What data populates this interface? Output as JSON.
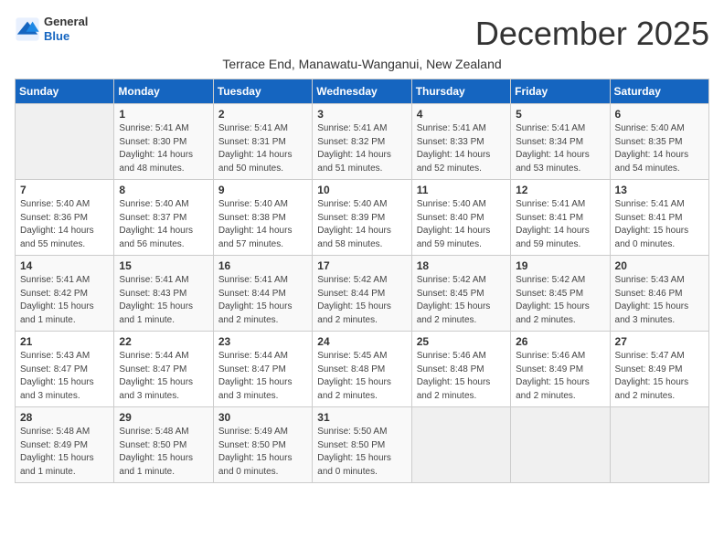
{
  "header": {
    "logo_general": "General",
    "logo_blue": "Blue",
    "month_title": "December 2025",
    "subtitle": "Terrace End, Manawatu-Wanganui, New Zealand"
  },
  "weekdays": [
    "Sunday",
    "Monday",
    "Tuesday",
    "Wednesday",
    "Thursday",
    "Friday",
    "Saturday"
  ],
  "weeks": [
    [
      {
        "day": "",
        "info": ""
      },
      {
        "day": "1",
        "info": "Sunrise: 5:41 AM\nSunset: 8:30 PM\nDaylight: 14 hours\nand 48 minutes."
      },
      {
        "day": "2",
        "info": "Sunrise: 5:41 AM\nSunset: 8:31 PM\nDaylight: 14 hours\nand 50 minutes."
      },
      {
        "day": "3",
        "info": "Sunrise: 5:41 AM\nSunset: 8:32 PM\nDaylight: 14 hours\nand 51 minutes."
      },
      {
        "day": "4",
        "info": "Sunrise: 5:41 AM\nSunset: 8:33 PM\nDaylight: 14 hours\nand 52 minutes."
      },
      {
        "day": "5",
        "info": "Sunrise: 5:41 AM\nSunset: 8:34 PM\nDaylight: 14 hours\nand 53 minutes."
      },
      {
        "day": "6",
        "info": "Sunrise: 5:40 AM\nSunset: 8:35 PM\nDaylight: 14 hours\nand 54 minutes."
      }
    ],
    [
      {
        "day": "7",
        "info": "Sunrise: 5:40 AM\nSunset: 8:36 PM\nDaylight: 14 hours\nand 55 minutes."
      },
      {
        "day": "8",
        "info": "Sunrise: 5:40 AM\nSunset: 8:37 PM\nDaylight: 14 hours\nand 56 minutes."
      },
      {
        "day": "9",
        "info": "Sunrise: 5:40 AM\nSunset: 8:38 PM\nDaylight: 14 hours\nand 57 minutes."
      },
      {
        "day": "10",
        "info": "Sunrise: 5:40 AM\nSunset: 8:39 PM\nDaylight: 14 hours\nand 58 minutes."
      },
      {
        "day": "11",
        "info": "Sunrise: 5:40 AM\nSunset: 8:40 PM\nDaylight: 14 hours\nand 59 minutes."
      },
      {
        "day": "12",
        "info": "Sunrise: 5:41 AM\nSunset: 8:41 PM\nDaylight: 14 hours\nand 59 minutes."
      },
      {
        "day": "13",
        "info": "Sunrise: 5:41 AM\nSunset: 8:41 PM\nDaylight: 15 hours\nand 0 minutes."
      }
    ],
    [
      {
        "day": "14",
        "info": "Sunrise: 5:41 AM\nSunset: 8:42 PM\nDaylight: 15 hours\nand 1 minute."
      },
      {
        "day": "15",
        "info": "Sunrise: 5:41 AM\nSunset: 8:43 PM\nDaylight: 15 hours\nand 1 minute."
      },
      {
        "day": "16",
        "info": "Sunrise: 5:41 AM\nSunset: 8:44 PM\nDaylight: 15 hours\nand 2 minutes."
      },
      {
        "day": "17",
        "info": "Sunrise: 5:42 AM\nSunset: 8:44 PM\nDaylight: 15 hours\nand 2 minutes."
      },
      {
        "day": "18",
        "info": "Sunrise: 5:42 AM\nSunset: 8:45 PM\nDaylight: 15 hours\nand 2 minutes."
      },
      {
        "day": "19",
        "info": "Sunrise: 5:42 AM\nSunset: 8:45 PM\nDaylight: 15 hours\nand 2 minutes."
      },
      {
        "day": "20",
        "info": "Sunrise: 5:43 AM\nSunset: 8:46 PM\nDaylight: 15 hours\nand 3 minutes."
      }
    ],
    [
      {
        "day": "21",
        "info": "Sunrise: 5:43 AM\nSunset: 8:47 PM\nDaylight: 15 hours\nand 3 minutes."
      },
      {
        "day": "22",
        "info": "Sunrise: 5:44 AM\nSunset: 8:47 PM\nDaylight: 15 hours\nand 3 minutes."
      },
      {
        "day": "23",
        "info": "Sunrise: 5:44 AM\nSunset: 8:47 PM\nDaylight: 15 hours\nand 3 minutes."
      },
      {
        "day": "24",
        "info": "Sunrise: 5:45 AM\nSunset: 8:48 PM\nDaylight: 15 hours\nand 2 minutes."
      },
      {
        "day": "25",
        "info": "Sunrise: 5:46 AM\nSunset: 8:48 PM\nDaylight: 15 hours\nand 2 minutes."
      },
      {
        "day": "26",
        "info": "Sunrise: 5:46 AM\nSunset: 8:49 PM\nDaylight: 15 hours\nand 2 minutes."
      },
      {
        "day": "27",
        "info": "Sunrise: 5:47 AM\nSunset: 8:49 PM\nDaylight: 15 hours\nand 2 minutes."
      }
    ],
    [
      {
        "day": "28",
        "info": "Sunrise: 5:48 AM\nSunset: 8:49 PM\nDaylight: 15 hours\nand 1 minute."
      },
      {
        "day": "29",
        "info": "Sunrise: 5:48 AM\nSunset: 8:50 PM\nDaylight: 15 hours\nand 1 minute."
      },
      {
        "day": "30",
        "info": "Sunrise: 5:49 AM\nSunset: 8:50 PM\nDaylight: 15 hours\nand 0 minutes."
      },
      {
        "day": "31",
        "info": "Sunrise: 5:50 AM\nSunset: 8:50 PM\nDaylight: 15 hours\nand 0 minutes."
      },
      {
        "day": "",
        "info": ""
      },
      {
        "day": "",
        "info": ""
      },
      {
        "day": "",
        "info": ""
      }
    ]
  ]
}
